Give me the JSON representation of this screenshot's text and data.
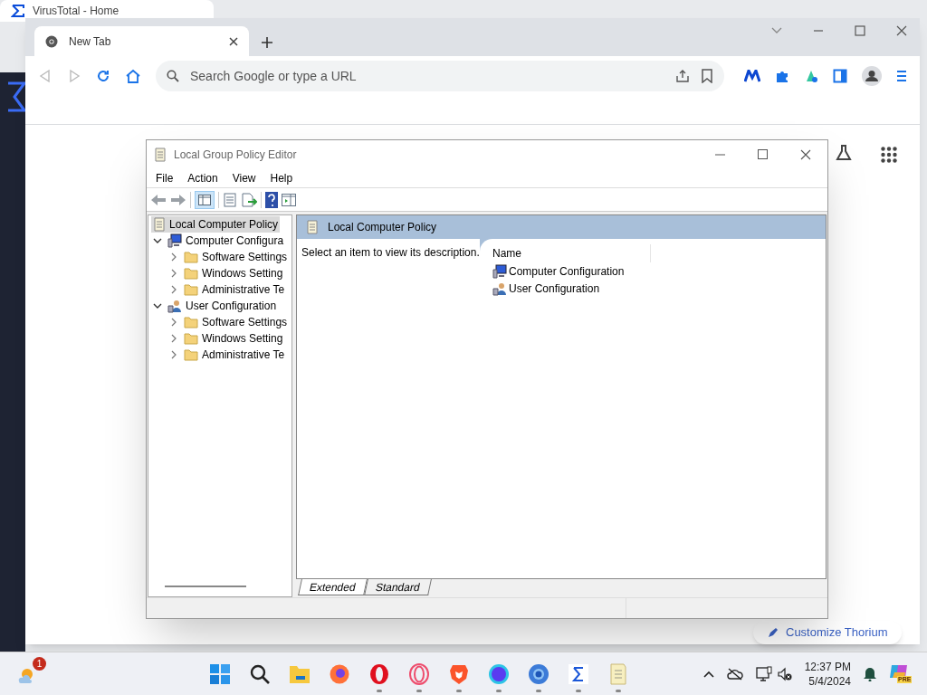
{
  "background_browser": {
    "tab_title": "VirusTotal - Home"
  },
  "browser": {
    "tabs": [
      {
        "title": "New Tab",
        "selected": true
      }
    ],
    "address_bar": {
      "placeholder": "Search Google or type a URL"
    },
    "customize_button": "Customize Thorium"
  },
  "gpedit": {
    "title": "Local Group Policy Editor",
    "menu": [
      "File",
      "Action",
      "View",
      "Help"
    ],
    "tree": [
      {
        "label": "Local Computer Policy",
        "kind": "policy",
        "selected": true,
        "children": [
          {
            "label": "Computer Configura",
            "kind": "computer",
            "selected": false,
            "expanded": true,
            "children": [
              {
                "label": "Software Settings",
                "kind": "folder",
                "selected": false,
                "expanded": false
              },
              {
                "label": "Windows Setting",
                "kind": "folder",
                "selected": false,
                "expanded": false
              },
              {
                "label": "Administrative Te",
                "kind": "folder",
                "selected": false,
                "expanded": false
              }
            ]
          },
          {
            "label": "User Configuration",
            "kind": "user",
            "selected": false,
            "expanded": true,
            "children": [
              {
                "label": "Software Settings",
                "kind": "folder",
                "selected": false,
                "expanded": false
              },
              {
                "label": "Windows Setting",
                "kind": "folder",
                "selected": false,
                "expanded": false
              },
              {
                "label": "Administrative Te",
                "kind": "folder",
                "selected": false,
                "expanded": false
              }
            ]
          }
        ]
      }
    ],
    "header": "Local Computer Policy",
    "description": "Select an item to view its description.",
    "list": {
      "columns": [
        "Name"
      ],
      "rows": [
        {
          "label": "Computer Configuration",
          "kind": "computer"
        },
        {
          "label": "User Configuration",
          "kind": "user"
        }
      ]
    },
    "view_tabs": [
      {
        "label": "Extended",
        "selected": true
      },
      {
        "label": "Standard",
        "selected": false
      }
    ]
  },
  "taskbar": {
    "weather_badge": "1",
    "apps": [
      {
        "kind": "start",
        "running": false
      },
      {
        "kind": "search",
        "running": false
      },
      {
        "kind": "explorer",
        "running": false
      },
      {
        "kind": "firefox",
        "running": false
      },
      {
        "kind": "opera",
        "running": true
      },
      {
        "kind": "operagx",
        "running": true
      },
      {
        "kind": "brave",
        "running": true
      },
      {
        "kind": "orb",
        "running": true
      },
      {
        "kind": "chromium",
        "running": true
      },
      {
        "kind": "sigma",
        "running": true
      },
      {
        "kind": "notes",
        "running": true
      }
    ],
    "clock": {
      "time": "12:37 PM",
      "date": "5/4/2024"
    },
    "copilot_badge": "PRE"
  }
}
